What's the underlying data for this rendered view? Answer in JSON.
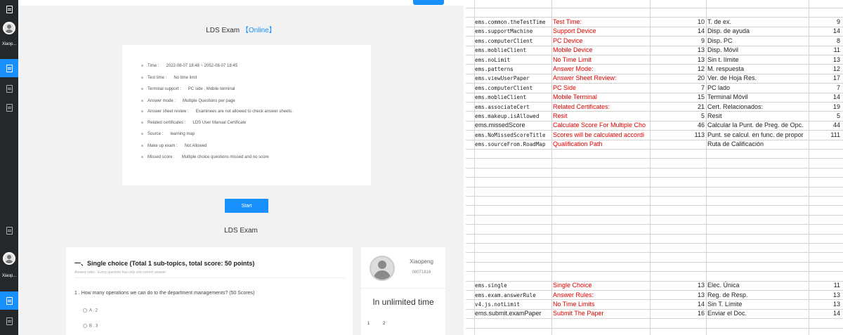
{
  "top_app": {
    "sidebar_user": "Xiaop...",
    "exam_title": "LDS Exam",
    "online_badge": "【Online】",
    "info": [
      {
        "label": "Time :",
        "value": "2022-08-07 18:48  ~  2052-08-07 18:45"
      },
      {
        "label": "Test time :",
        "value": "No time limit"
      },
      {
        "label": "Terminal support :",
        "value": "PC side ,  Mobile terminal"
      },
      {
        "label": "Answer mode :",
        "value": "Multiple Questions per page"
      },
      {
        "label": "Answer sheet review :",
        "value": "Examinees are not allowed to check answer sheets."
      },
      {
        "label": "Related certificates :",
        "value": "LDS  User Manual Certificate"
      },
      {
        "label": "Source :",
        "value": "learning map"
      },
      {
        "label": "Make up exam :",
        "value": "Not Allowed"
      },
      {
        "label": "Missed score :",
        "value": "Multiple choice questions missed and no score"
      }
    ],
    "start_label": "Start"
  },
  "bottom_app": {
    "sidebar_user": "Xiaop...",
    "exam_title": "LDS Exam",
    "section_title": "一、Single choice (Total 1 sub-topics, total score: 50 points)",
    "rules": "Answer rules :  Every question has only one correct answer",
    "question": "1 . How many operations we can do to the department managements?   (50 Scores)",
    "options": [
      "A . 2",
      "B . 3"
    ],
    "user_name": "Xiaopeng",
    "user_id": "08071816",
    "time_text": "In unlimited time",
    "pages": [
      "1",
      "2"
    ]
  },
  "sheet": {
    "rows_top": [
      {
        "key": "ems.common.theTestTime",
        "en": "Test Time:",
        "n1": "10",
        "es": "T. de ex.",
        "n2": "9"
      },
      {
        "key": "ems.supportMachine",
        "en": "Support Device",
        "n1": "14",
        "es": "Disp. de ayuda",
        "n2": "14"
      },
      {
        "key": "ems.computerClient",
        "en": "PC Device",
        "n1": "9",
        "es": "Disp. PC",
        "n2": "8"
      },
      {
        "key": "ems.moblieClient",
        "en": "Mobile Device",
        "n1": "13",
        "es": "Disp. Móvil",
        "n2": "11"
      },
      {
        "key": "ems.noLimit",
        "en": "No Time Limit",
        "n1": "13",
        "es": "Sin t. límite",
        "n2": "13"
      },
      {
        "key": "ems.patterns",
        "en": "Answer Mode:",
        "n1": "12",
        "es": "M. respuesta",
        "n2": "12"
      },
      {
        "key": "ems.viewUserPaper",
        "en": "Answer Sheet Review:",
        "n1": "20",
        "es": "Ver. de Hoja Res.",
        "n2": "17"
      },
      {
        "key": "ems.computerClient",
        "en": "PC Side",
        "n1": "7",
        "es": "PC lado",
        "n2": "7"
      },
      {
        "key": "ems.moblieClient",
        "en": "Mobile Terminal",
        "n1": "15",
        "es": "Terminal Móvil",
        "n2": "14"
      },
      {
        "key": "ems.associateCert",
        "en": "Related Certificates:",
        "n1": "21",
        "es": "Cert. Relacionados:",
        "n2": "19"
      },
      {
        "key": "ems.makeup.isAllowed",
        "en": "Resit",
        "n1": "5",
        "es": "Resit",
        "n2": "5"
      },
      {
        "key": "ems.missedScore",
        "en": "Calculate Score For Multiple Cho",
        "n1": "46",
        "es": "Calcular la Punt. de Preg. de Opc.",
        "n2": "44"
      },
      {
        "key": "ems.NoMissedScoreTitle",
        "en": "Scores will be calculated accordi",
        "n1": "113",
        "es": "Punt. se calcul. en func. de propor",
        "n2": "111"
      },
      {
        "key": "ems.sourceFrom.RoadMap",
        "en": "Qualification Path",
        "n1": "",
        "es": "Ruta de Calificación",
        "n2": ""
      }
    ],
    "rows_bottom": [
      {
        "key": "ems.single",
        "en": "Single Choice",
        "n1": "13",
        "es": "Elec. Única",
        "n2": "11"
      },
      {
        "key": "ems.exam.answerRule",
        "en": "Answer Rules:",
        "n1": "13",
        "es": "Reg. de Resp.",
        "n2": "13"
      },
      {
        "key": "v4.js.notLimit",
        "en": "No Time Limits",
        "n1": "14",
        "es": "Sin T. Límite",
        "n2": "13"
      },
      {
        "key": "ems.submit.examPaper",
        "en": "Submit The Paper",
        "n1": "16",
        "es": "Enviar el Doc.",
        "n2": "14"
      }
    ]
  }
}
